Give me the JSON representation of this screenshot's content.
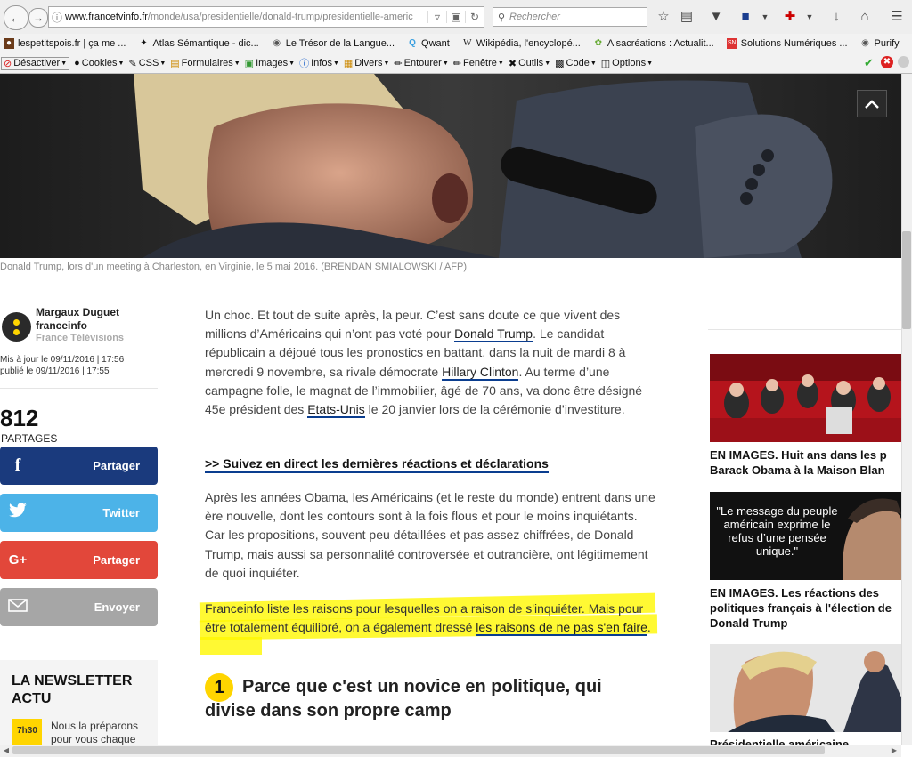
{
  "browser": {
    "url_host": "www.francetvinfo.fr",
    "url_path": "/monde/usa/presidentielle/donald-trump/presidentielle-americ",
    "search_placeholder": "Rechercher",
    "bookmarks": [
      {
        "label": "lespetitspois.fr | ça me ...",
        "icon": "pea-icon"
      },
      {
        "label": "Atlas Sémantique - dic...",
        "icon": "atlas-icon"
      },
      {
        "label": "Le Trésor de la Langue...",
        "icon": "globe-icon"
      },
      {
        "label": "Qwant",
        "icon": "qwant-icon"
      },
      {
        "label": "Wikipédia, l'encyclopé...",
        "icon": "wikipedia-icon"
      },
      {
        "label": "Alsacréations : Actualit...",
        "icon": "alsacreations-icon"
      },
      {
        "label": "Solutions Numériques ...",
        "icon": "sn-icon"
      },
      {
        "label": "Purify",
        "icon": "globe-icon"
      }
    ],
    "devtools": [
      "Désactiver",
      "Cookies",
      "CSS",
      "Formulaires",
      "Images",
      "Infos",
      "Divers",
      "Entourer",
      "Fenêtre",
      "Outils",
      "Code",
      "Options"
    ]
  },
  "hero": {
    "caption": "Donald Trump, lors d'un meeting à Charleston, en Virginie, le 5 mai 2016. (BRENDAN SMIALOWSKI / AFP)"
  },
  "author": {
    "name": "Margaux Duguet",
    "outlet": "franceinfo",
    "org": "France Télévisions",
    "updated": "Mis à jour le 09/11/2016 | 17:56",
    "published": "publié le 09/11/2016 | 17:55"
  },
  "share": {
    "count": "812",
    "count_label": "PARTAGES",
    "facebook": "Partager",
    "twitter": "Twitter",
    "google": "Partager",
    "email": "Envoyer"
  },
  "newsletter": {
    "title": "LA NEWSLETTER ACTU",
    "badge": "7h30",
    "text": "Nous la préparons pour vous chaque"
  },
  "article": {
    "p1_a": "Un choc. Et tout de suite après, la peur. C’est sans doute ce que vivent des millions d’Américains qui n’ont pas voté pour ",
    "p1_link1": "Donald Trump",
    "p1_b": ". Le candidat républicain a déjoué tous les pronostics en battant, dans la nuit de mardi 8 à mercredi 9 novembre, sa rivale démocrate ",
    "p1_link2": "Hillary Clinton",
    "p1_c": ". Au terme d’une campagne folle, le magnat de l’immobilier, âgé de 70 ans, va donc être désigné 45e président des ",
    "p1_link3": "Etats-Unis",
    "p1_d": " le 20 janvier lors de la cérémonie d’investiture.",
    "direct_link": ">> Suivez en direct les dernières réactions et déclarations",
    "p2": "Après les années Obama, les Américains (et le reste du monde) entrent dans une ère nouvelle, dont les contours sont à la fois flous et pour le moins inquiétants. Car les propositions, souvent peu détaillées et pas assez chiffrées, de Donald Trump, mais aussi sa personnalité controversée et outrancière, ont légitimement de quoi inquiéter.",
    "p3_a": "Franceinfo liste les raisons pour lesquelles on a raison de s'inquiéter. Mais pour être totalement équilibré, on a également dressé ",
    "p3_link": "les raisons de ne pas s'en faire",
    "p3_b": ".",
    "section_number": "1",
    "section_title": "Parce que c'est un novice en politique, qui divise dans son propre camp"
  },
  "related": [
    {
      "title_line1": "EN IMAGES. Huit ans dans les p",
      "title_line2": "Barack Obama à la Maison Blan"
    },
    {
      "quote": "\"Le message du peuple américain exprime le refus d’une pensée unique.\"",
      "title": "EN IMAGES. Les réactions des politiques français à l'élection de Donald Trump"
    },
    {
      "title": "Présidentielle américaine"
    }
  ]
}
